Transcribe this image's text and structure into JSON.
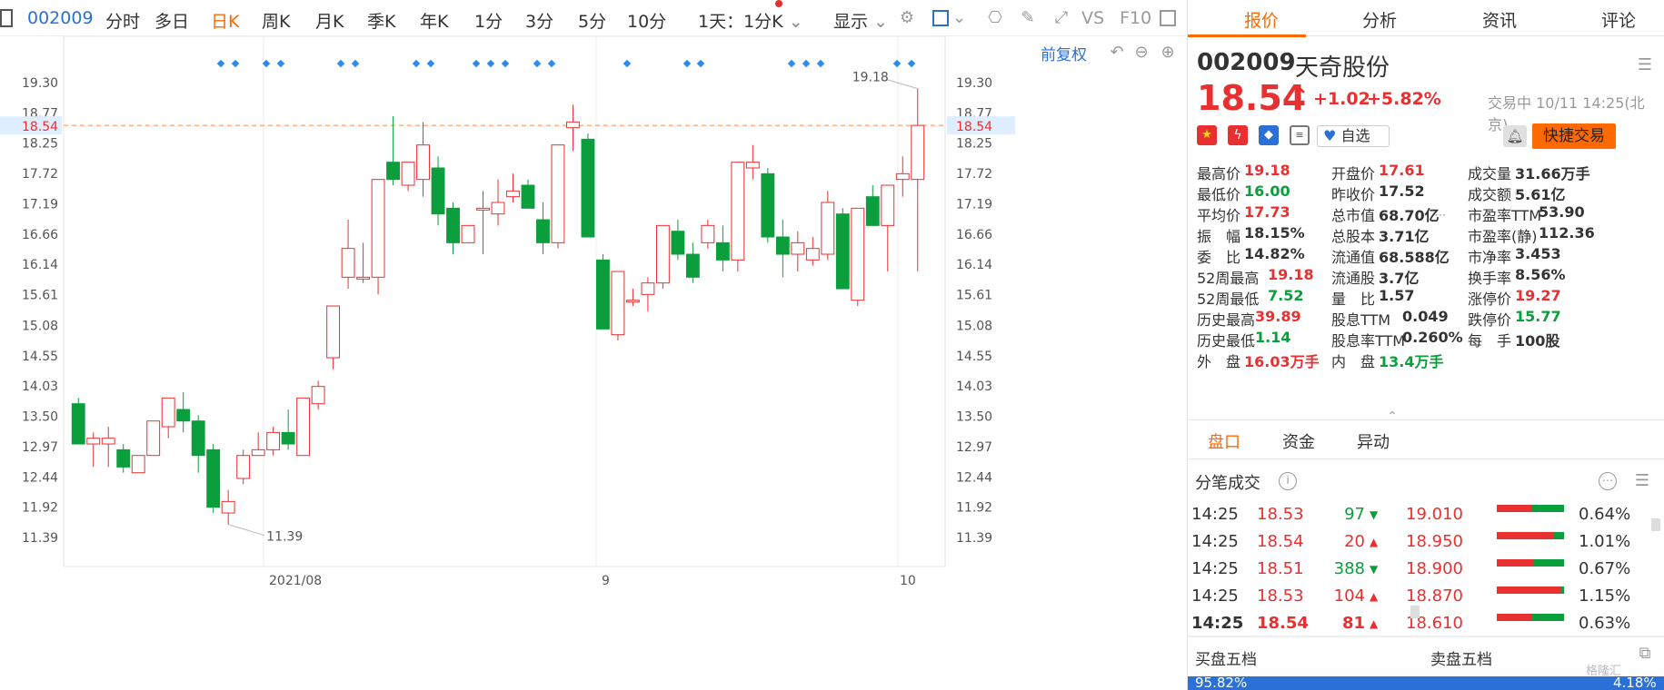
{
  "toolbar": {
    "code": "002009",
    "items": [
      "分时",
      "多日",
      "日K",
      "周K",
      "月K",
      "季K",
      "年K",
      "1分",
      "3分",
      "5分",
      "10分"
    ],
    "active": "日K",
    "interval_select": "1天：1分K",
    "display_label": "显示",
    "vs_label": "VS",
    "f10_label": "F10"
  },
  "chart": {
    "restore_label": "前复权",
    "current_price": "18.54",
    "high_label": "19.18",
    "low_label": "11.39",
    "x_labels": [
      "2021/08",
      "9",
      "10"
    ]
  },
  "chart_data": {
    "type": "candlestick",
    "yticks": [
      19.3,
      18.77,
      18.25,
      17.72,
      17.19,
      16.66,
      16.14,
      15.61,
      15.08,
      14.55,
      14.03,
      13.5,
      12.97,
      12.44,
      11.92,
      11.39
    ],
    "ylim": [
      11.39,
      19.3
    ],
    "current_price": 18.54,
    "ohlc": [
      [
        13.7,
        13.8,
        13.0,
        13.0
      ],
      [
        13.0,
        13.2,
        12.6,
        13.1
      ],
      [
        13.0,
        13.3,
        12.6,
        13.1
      ],
      [
        12.9,
        13.0,
        12.5,
        12.6
      ],
      [
        12.5,
        12.8,
        12.5,
        12.8
      ],
      [
        12.8,
        13.4,
        12.8,
        13.4
      ],
      [
        13.3,
        13.8,
        13.1,
        13.8
      ],
      [
        13.6,
        13.9,
        13.2,
        13.4
      ],
      [
        13.4,
        13.5,
        12.5,
        12.8
      ],
      [
        12.9,
        13.0,
        11.8,
        11.9
      ],
      [
        11.8,
        12.2,
        11.6,
        12.0
      ],
      [
        12.4,
        12.9,
        12.3,
        12.8
      ],
      [
        12.8,
        13.2,
        12.8,
        12.9
      ],
      [
        12.9,
        13.3,
        12.8,
        13.2
      ],
      [
        13.2,
        13.6,
        12.9,
        13.0
      ],
      [
        12.8,
        13.8,
        12.8,
        13.8
      ],
      [
        13.7,
        14.1,
        13.6,
        14.0
      ],
      [
        14.5,
        15.4,
        14.3,
        15.4
      ],
      [
        15.9,
        16.9,
        15.7,
        16.4
      ],
      [
        15.9,
        16.5,
        15.8,
        15.9
      ],
      [
        15.9,
        17.6,
        15.6,
        17.6
      ],
      [
        17.9,
        18.7,
        17.5,
        17.6
      ],
      [
        17.5,
        17.9,
        17.4,
        17.9
      ],
      [
        17.6,
        18.6,
        17.3,
        18.2
      ],
      [
        17.8,
        18.0,
        16.8,
        17.0
      ],
      [
        17.1,
        17.2,
        16.3,
        16.5
      ],
      [
        16.5,
        16.8,
        16.5,
        16.8
      ],
      [
        17.1,
        17.4,
        16.3,
        17.1
      ],
      [
        17.0,
        17.6,
        16.8,
        17.2
      ],
      [
        17.3,
        17.7,
        17.2,
        17.4
      ],
      [
        17.5,
        17.6,
        17.1,
        17.1
      ],
      [
        16.9,
        17.2,
        16.3,
        16.5
      ],
      [
        16.5,
        18.2,
        16.4,
        18.2
      ],
      [
        18.5,
        18.9,
        18.1,
        18.6
      ],
      [
        18.3,
        18.4,
        16.6,
        16.6
      ],
      [
        16.2,
        16.3,
        15.0,
        15.0
      ],
      [
        14.9,
        16.0,
        14.8,
        16.0
      ],
      [
        15.5,
        15.7,
        15.4,
        15.5
      ],
      [
        15.6,
        15.9,
        15.3,
        15.8
      ],
      [
        15.8,
        16.8,
        15.7,
        16.8
      ],
      [
        16.7,
        16.9,
        16.2,
        16.3
      ],
      [
        16.3,
        16.5,
        15.8,
        15.9
      ],
      [
        16.5,
        16.9,
        16.4,
        16.8
      ],
      [
        16.5,
        16.8,
        16.0,
        16.2
      ],
      [
        16.2,
        17.9,
        16.0,
        17.9
      ],
      [
        17.8,
        18.2,
        17.6,
        17.9
      ],
      [
        17.7,
        17.8,
        16.5,
        16.6
      ],
      [
        16.6,
        16.9,
        15.9,
        16.3
      ],
      [
        16.3,
        16.7,
        16.0,
        16.5
      ],
      [
        16.2,
        16.6,
        16.1,
        16.4
      ],
      [
        16.3,
        17.4,
        16.2,
        17.2
      ],
      [
        17.0,
        17.1,
        15.7,
        15.7
      ],
      [
        15.5,
        17.1,
        15.4,
        17.1
      ],
      [
        17.3,
        17.5,
        16.8,
        16.8
      ],
      [
        16.8,
        17.5,
        16.0,
        17.5
      ],
      [
        17.6,
        18.0,
        17.3,
        17.7
      ],
      [
        17.6,
        19.18,
        16.0,
        18.54
      ]
    ]
  },
  "quote": {
    "tabs": [
      "报价",
      "分析",
      "资讯",
      "评论"
    ],
    "active_tab": "报价",
    "code": "002009",
    "name": "天奇股份",
    "price": "18.54",
    "arrow": "↑",
    "change": "+1.02",
    "pct": "+5.82%",
    "status": "交易中 10/11 14:25(北京)",
    "watch_label": "自选",
    "trade_label": "快捷交易",
    "stats": [
      [
        {
          "k": "最高价",
          "v": "19.18",
          "c": "red"
        },
        {
          "k": "开盘价",
          "v": "17.61",
          "c": "red"
        },
        {
          "k": "成交量",
          "v": "31.66万手",
          "c": "dark"
        }
      ],
      [
        {
          "k": "最低价",
          "v": "16.00",
          "c": "green"
        },
        {
          "k": "昨收价",
          "v": "17.52",
          "c": "dark"
        },
        {
          "k": "成交额",
          "v": "5.61亿",
          "c": "dark"
        }
      ],
      [
        {
          "k": "平均价",
          "v": "17.73",
          "c": "red"
        },
        {
          "k": "总市值",
          "v": "68.70亿",
          "c": "dark"
        },
        {
          "k": "市盈率TTM",
          "v": "53.90",
          "c": "dark"
        }
      ],
      [
        {
          "k": "振　幅",
          "v": "18.15%",
          "c": "dark"
        },
        {
          "k": "总股本",
          "v": "3.71亿",
          "c": "dark"
        },
        {
          "k": "市盈率(静)",
          "v": "112.36",
          "c": "dark"
        }
      ],
      [
        {
          "k": "委　比",
          "v": "14.82%",
          "c": "dark"
        },
        {
          "k": "流通值",
          "v": "68.588亿",
          "c": "dark"
        },
        {
          "k": "市净率",
          "v": "3.453",
          "c": "dark"
        }
      ],
      [
        {
          "k": "52周最高",
          "v": "19.18",
          "c": "red"
        },
        {
          "k": "流通股",
          "v": "3.7亿",
          "c": "dark"
        },
        {
          "k": "换手率",
          "v": "8.56%",
          "c": "dark"
        }
      ],
      [
        {
          "k": "52周最低",
          "v": "7.52",
          "c": "green"
        },
        {
          "k": "量　比",
          "v": "1.57",
          "c": "dark"
        },
        {
          "k": "涨停价",
          "v": "19.27",
          "c": "red"
        }
      ],
      [
        {
          "k": "历史最高",
          "v": "39.89",
          "c": "red"
        },
        {
          "k": "股息TTM",
          "v": "0.049",
          "c": "dark"
        },
        {
          "k": "跌停价",
          "v": "15.77",
          "c": "green"
        }
      ],
      [
        {
          "k": "历史最低",
          "v": "1.14",
          "c": "green"
        },
        {
          "k": "股息率TTM",
          "v": "0.260%",
          "c": "dark"
        },
        {
          "k": "每　手",
          "v": "100股",
          "c": "dark"
        }
      ],
      [
        {
          "k": "外　盘",
          "v": "16.03万手",
          "c": "red"
        },
        {
          "k": "内　盘",
          "v": "13.4万手",
          "c": "green"
        }
      ]
    ]
  },
  "lower": {
    "tabs": [
      "盘口",
      "资金",
      "异动"
    ],
    "active_tab": "盘口",
    "ticks_title": "分笔成交",
    "ticks": [
      {
        "time": "14:25",
        "price": "18.53",
        "price_c": "red",
        "vol": "97",
        "vol_c": "green",
        "dir": "down",
        "bold": false
      },
      {
        "time": "14:25",
        "price": "18.54",
        "price_c": "red",
        "vol": "20",
        "vol_c": "red",
        "dir": "up",
        "bold": false
      },
      {
        "time": "14:25",
        "price": "18.51",
        "price_c": "red",
        "vol": "388",
        "vol_c": "green",
        "dir": "down",
        "bold": false
      },
      {
        "time": "14:25",
        "price": "18.53",
        "price_c": "red",
        "vol": "104",
        "vol_c": "red",
        "dir": "up",
        "bold": false
      },
      {
        "time": "14:25",
        "price": "18.54",
        "price_c": "red",
        "vol": "81",
        "vol_c": "red",
        "dir": "up",
        "bold": true
      }
    ],
    "levels": [
      {
        "price": "19.010",
        "pct": "0.64%",
        "fill": 0.64
      },
      {
        "price": "18.950",
        "pct": "1.01%",
        "fill": 1.01
      },
      {
        "price": "18.900",
        "pct": "0.67%",
        "fill": 0.67
      },
      {
        "price": "18.870",
        "pct": "1.15%",
        "fill": 1.15
      },
      {
        "price": "18.610",
        "pct": "0.63%",
        "fill": 0.63
      }
    ],
    "buy_label": "买盘五档",
    "sell_label": "卖盘五档",
    "buy_pct": "95.82%",
    "sell_pct": "4.18%"
  },
  "colors": {
    "up": "#e93030",
    "down": "#0a9e3c",
    "accent": "#ff6a00",
    "blue": "#2a70d6"
  }
}
